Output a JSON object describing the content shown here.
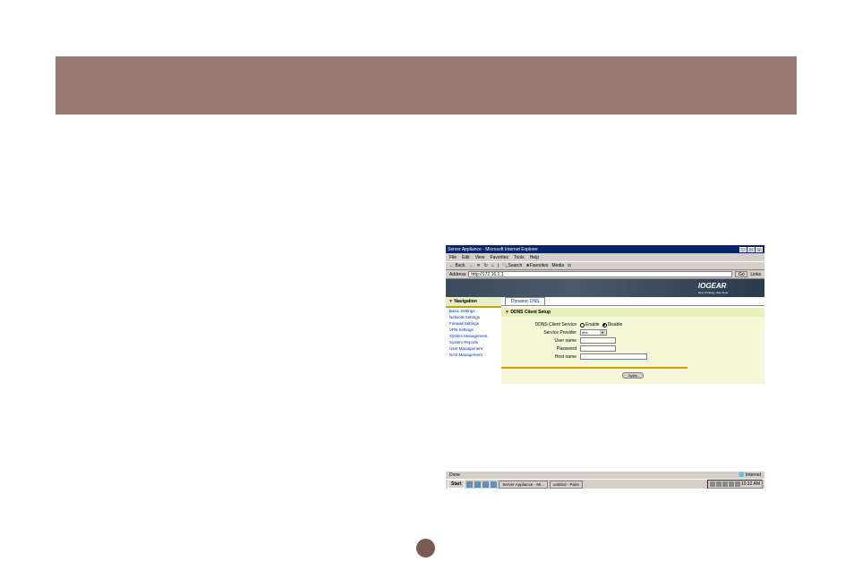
{
  "window": {
    "title": "Server Appliance - Microsoft Internet Explorer"
  },
  "menu": {
    "file": "File",
    "edit": "Edit",
    "view": "View",
    "favorites": "Favorites",
    "tools": "Tools",
    "help": "Help"
  },
  "toolbar": {
    "back": "Back",
    "search": "Search",
    "favorites": "Favorites",
    "media": "Media"
  },
  "addressbar": {
    "label": "Address",
    "url": "http://172.16.1.1",
    "go": "Go",
    "links": "Links"
  },
  "brand": {
    "name": "IOGEAR",
    "tagline": "New Thinking. New Style."
  },
  "sidebar": {
    "header": "Navigation",
    "items": [
      "Basic Settings",
      "Network Settings",
      "Firewall Settings",
      "VPN Settings",
      "System Management",
      "System Reports",
      "User Management",
      "NAS Management"
    ]
  },
  "tabs": {
    "dynamicdns": "Dynamic DNS"
  },
  "section": {
    "title": "DDNS Client Setup"
  },
  "form": {
    "service_label": "DDNS Client Service",
    "enable": "Enable",
    "disable": "Disable",
    "provider_label": "Service Provider",
    "provider_value": "dhs",
    "username_label": "User name",
    "password_label": "Password",
    "hostname_label": "Host name",
    "apply": "Apply"
  },
  "status": {
    "done": "Done",
    "zone": "Internet"
  },
  "taskbar": {
    "start": "Start",
    "app1": "Server Appliance - Mi...",
    "app2": "untitled - Paint",
    "clock": "10:32 AM"
  }
}
